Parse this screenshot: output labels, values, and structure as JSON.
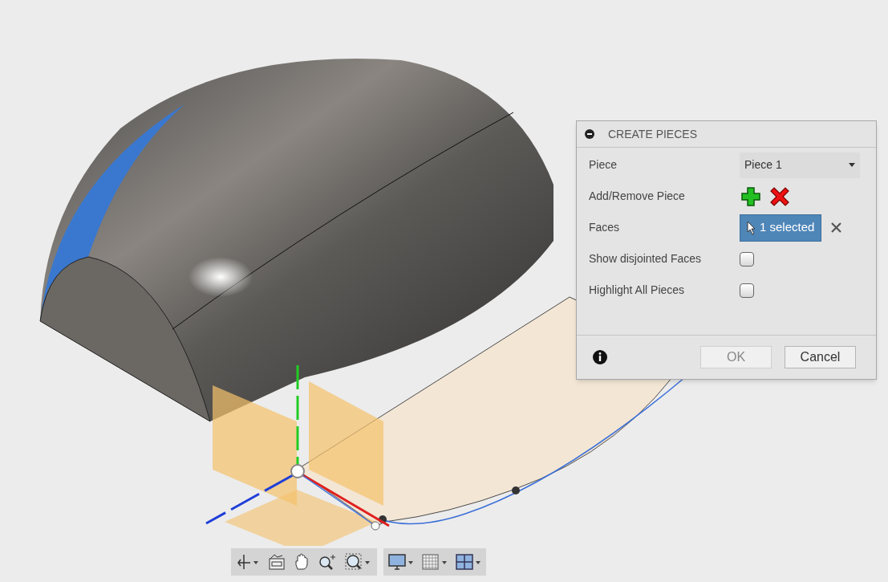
{
  "dialog": {
    "title": "CREATE PIECES",
    "expanded": true,
    "rows": [
      {
        "kind": "dropdown",
        "label": "Piece",
        "value": "Piece 1"
      },
      {
        "kind": "add_remove",
        "label": "Add/Remove Piece"
      },
      {
        "kind": "selection",
        "label": "Faces",
        "value": "1 selected",
        "selected": true
      },
      {
        "kind": "checkbox",
        "label": "Show disjointed Faces",
        "checked": false
      },
      {
        "kind": "checkbox",
        "label": "Highlight All Pieces",
        "checked": false
      }
    ],
    "buttons": [
      {
        "label": "OK",
        "disabled": true
      },
      {
        "label": "Cancel",
        "disabled": false
      }
    ]
  }
}
